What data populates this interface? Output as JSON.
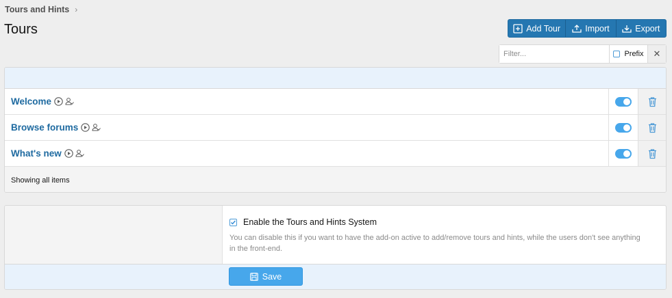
{
  "breadcrumb": {
    "label": "Tours and Hints",
    "separator": "›"
  },
  "page": {
    "title": "Tours"
  },
  "toolbar": {
    "add_label": "Add Tour",
    "import_label": "Import",
    "export_label": "Export"
  },
  "filter": {
    "placeholder": "Filter...",
    "prefix_label": "Prefix",
    "clear_label": "✕"
  },
  "tours": [
    {
      "title": "Welcome",
      "enabled": true
    },
    {
      "title": "Browse forums",
      "enabled": true
    },
    {
      "title": "What's new",
      "enabled": true
    }
  ],
  "list_footer": "Showing all items",
  "options": {
    "enable_label": "Enable the Tours and Hints System",
    "enable_checked": true,
    "enable_hint": "You can disable this if you want to have the add-on active to add/remove tours and hints, while the users don't see anything in the front-end."
  },
  "save_label": "Save",
  "colors": {
    "accent": "#2577b1",
    "toggle_on": "#47a7eb",
    "link": "#1e6aa0"
  }
}
